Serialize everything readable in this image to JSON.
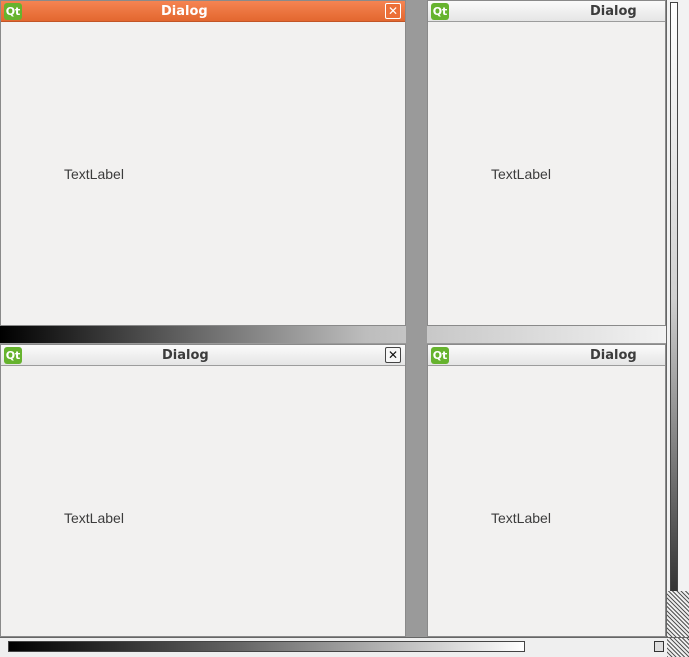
{
  "windows": [
    {
      "title": "Dialog",
      "label": "TextLabel",
      "icon": "Qt",
      "close": "✕",
      "active": true
    },
    {
      "title": "Dialog",
      "label": "TextLabel",
      "icon": "Qt",
      "active": false
    },
    {
      "title": "Dialog",
      "label": "TextLabel",
      "icon": "Qt",
      "close": "✕",
      "active": false
    },
    {
      "title": "Dialog",
      "label": "TextLabel",
      "icon": "Qt",
      "active": false
    }
  ],
  "colors": {
    "active_titlebar": "#e86d37",
    "qt_logo": "#66b32e",
    "window_bg": "#f2f1f0",
    "desktop_bg": "#9a9a9a"
  },
  "icons": [
    "qt-logo-icon",
    "close-icon"
  ]
}
